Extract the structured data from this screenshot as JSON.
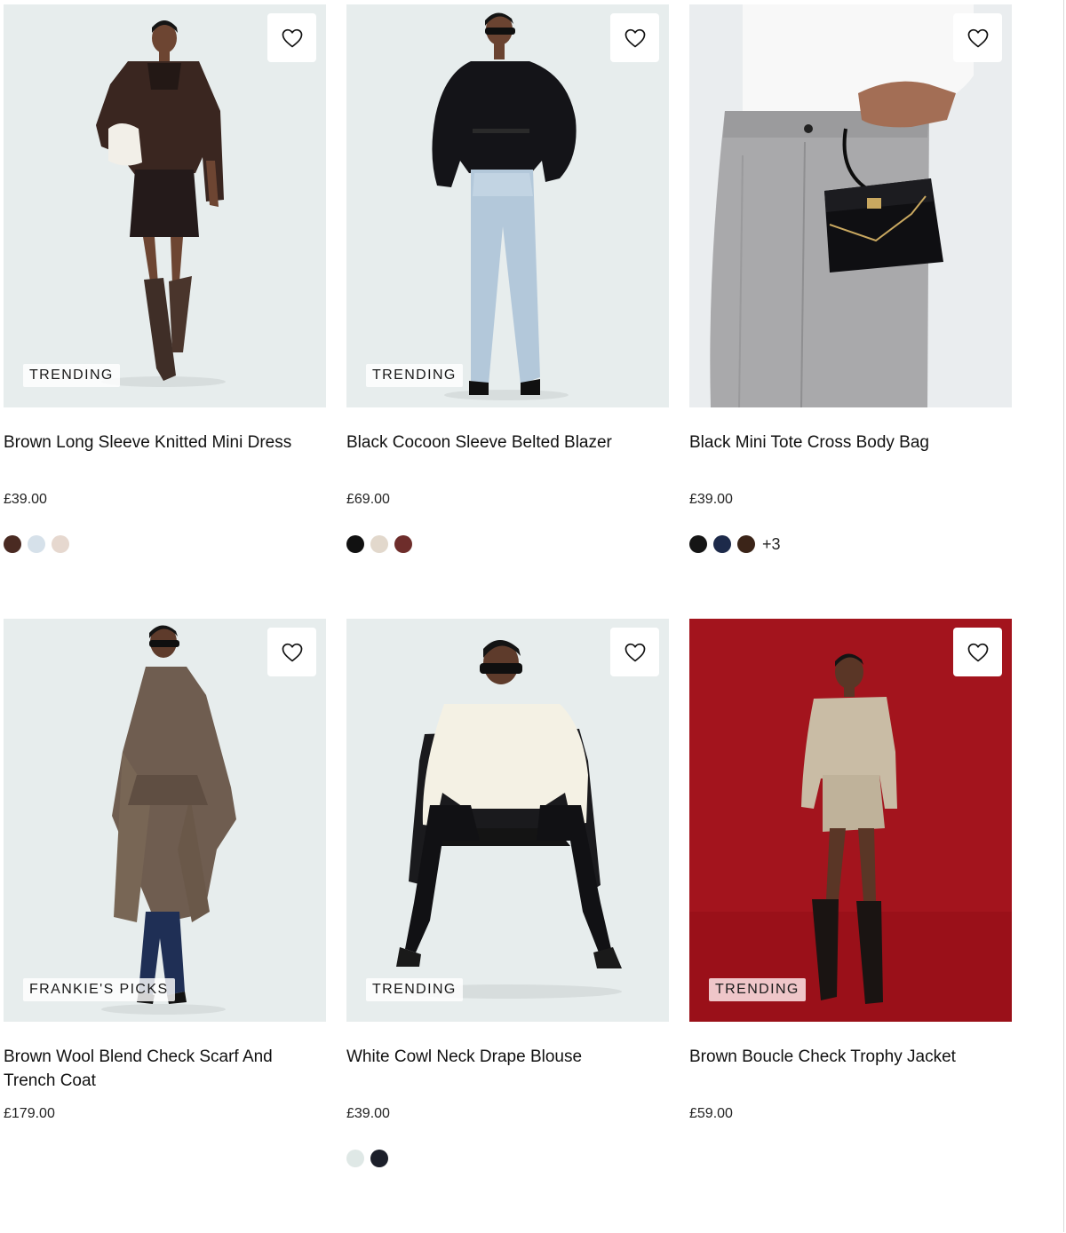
{
  "products": [
    {
      "name": "Brown Long Sleeve Knitted Mini Dress",
      "price": "£39.00",
      "badge": "TRENDING",
      "badge_style": "light",
      "background": "#e6ecec",
      "swatches": [
        "#4a2a22",
        "#d6e1ea",
        "#e6d8cf"
      ],
      "more": ""
    },
    {
      "name": "Black Cocoon Sleeve Belted Blazer",
      "price": "£69.00",
      "badge": "TRENDING",
      "badge_style": "light",
      "background": "#e6ecec",
      "swatches": [
        "#111111",
        "#e2d8cc",
        "#6e2d2b"
      ],
      "more": ""
    },
    {
      "name": "Black Mini Tote Cross Body Bag",
      "price": "£39.00",
      "badge": "",
      "badge_style": "light",
      "background": "#e9ecee",
      "swatches": [
        "#151515",
        "#1d2a4a",
        "#3b2418"
      ],
      "more": "+3"
    },
    {
      "name": "Brown Wool Blend Check Scarf And Trench Coat",
      "price": "£179.00",
      "badge": "FRANKIE'S PICKS",
      "badge_style": "light",
      "background": "#e6ecec",
      "swatches": [],
      "more": ""
    },
    {
      "name": "White Cowl Neck Drape Blouse",
      "price": "£39.00",
      "badge": "TRENDING",
      "badge_style": "light",
      "background": "#e6ecec",
      "swatches": [
        "#dfe8e6",
        "#1c1f2a"
      ],
      "more": ""
    },
    {
      "name": "Brown Boucle Check Trophy Jacket",
      "price": "£59.00",
      "badge": "TRENDING",
      "badge_style": "pink",
      "background": "#a3141d",
      "swatches": [],
      "more": ""
    }
  ],
  "icons": {
    "wishlist": "heart-outline-icon"
  }
}
